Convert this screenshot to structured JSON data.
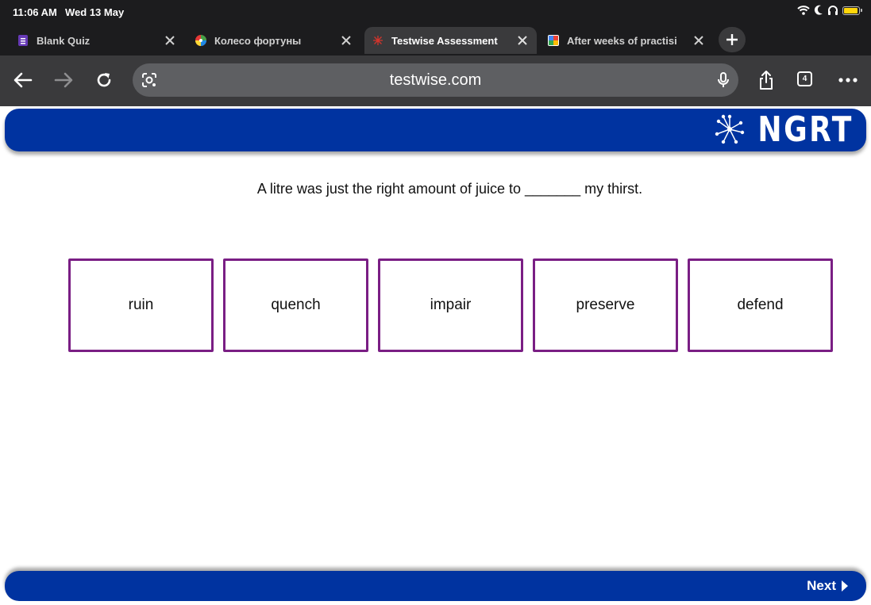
{
  "status_bar": {
    "time": "11:06 AM",
    "date": "Wed 13 May",
    "battery_level_pct": 85,
    "battery_color": "#ffd60a"
  },
  "tabs": [
    {
      "label": "Blank Quiz",
      "favicon": "google-forms-icon",
      "active": false
    },
    {
      "label": "Колесо фортуны",
      "favicon": "color-wheel-icon",
      "active": false
    },
    {
      "label": "Testwise Assessment",
      "favicon": "testwise-icon",
      "active": true
    },
    {
      "label": "After weeks of practisi",
      "favicon": "gd-icon",
      "active": false
    }
  ],
  "toolbar": {
    "url": "testwise.com",
    "tab_count": "4"
  },
  "page": {
    "header_brand": "NGRT",
    "question": "A litre was just the right amount of juice to _______ my thirst.",
    "options": [
      "ruin",
      "quench",
      "impair",
      "preserve",
      "defend"
    ],
    "next_label": "Next",
    "accent_color": "#0033a0",
    "option_border_color": "#7a1e84"
  }
}
